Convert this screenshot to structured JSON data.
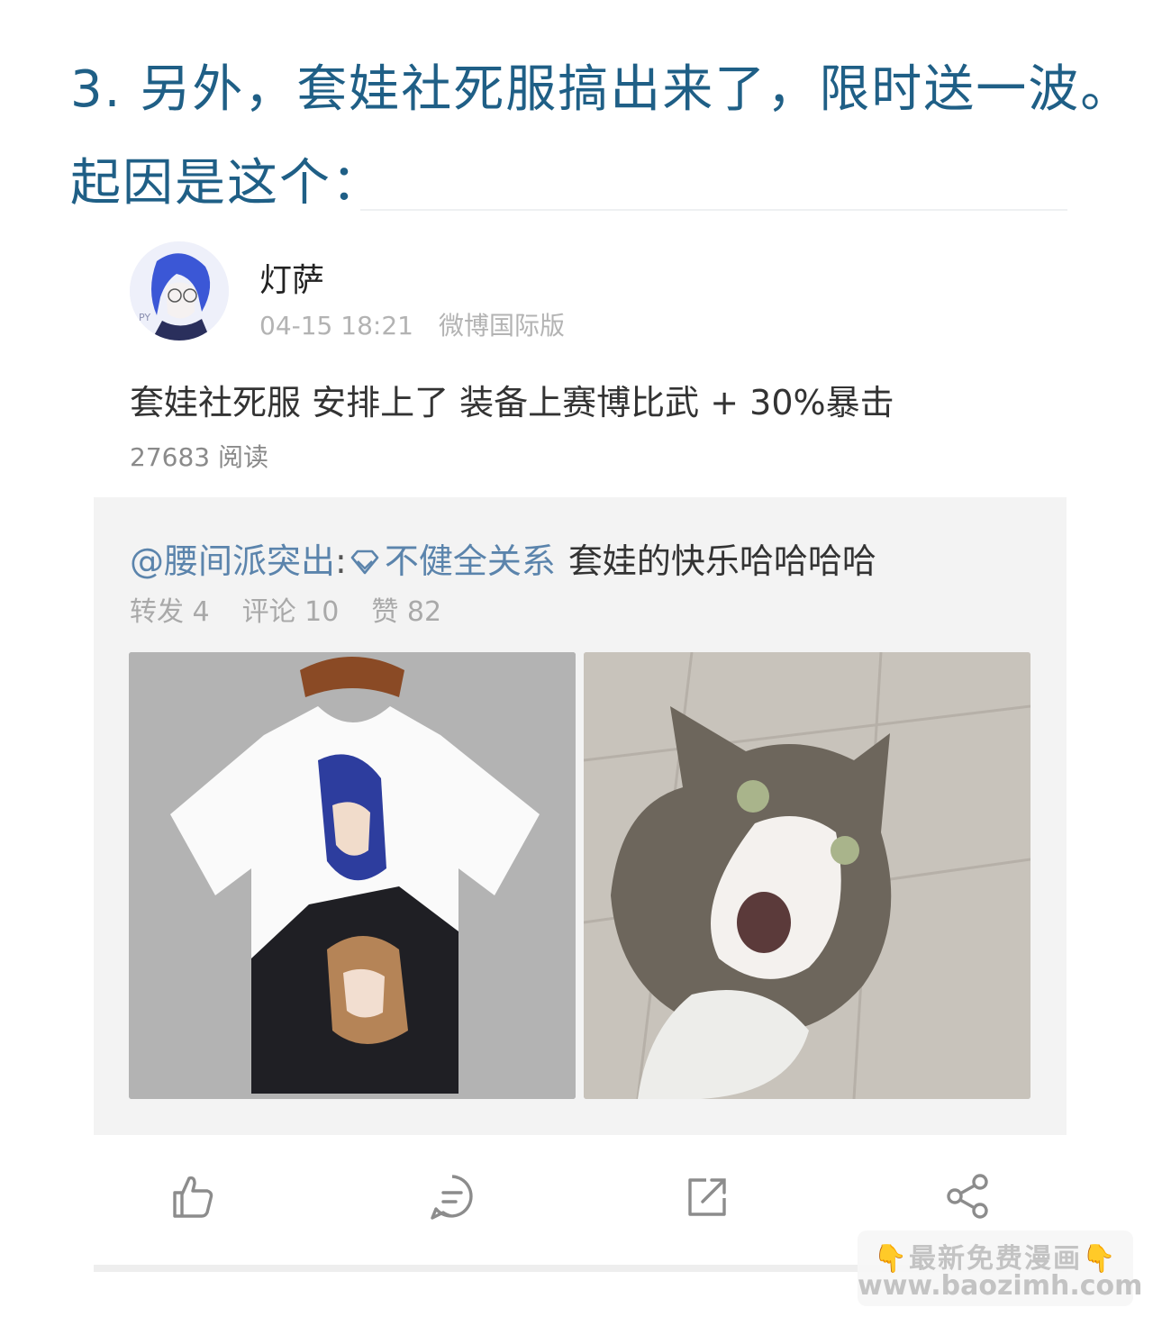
{
  "heading": {
    "line1": "3. 另外，套娃社死服搞出来了，限时送一波。",
    "line2": "起因是这个："
  },
  "post": {
    "username": "灯萨",
    "timestamp": "04-15 18:21",
    "source": "微博国际版",
    "text": "套娃社死服 安排上了 装备上赛博比武 + 30%暴击",
    "reads": "27683 阅读"
  },
  "quoted": {
    "mention": "@腰间派突出",
    "colon": ":",
    "gem_icon": "diamond-icon",
    "tag": "不健全关系",
    "text": "套娃的快乐哈哈哈哈",
    "reposts": "转发 4",
    "comments": "评论 10",
    "likes": "赞 82",
    "images": [
      {
        "description_icon": "tshirt-image"
      },
      {
        "description_icon": "cat-image"
      }
    ]
  },
  "actions": {
    "icons": [
      "thumbs-up-icon",
      "comment-icon",
      "repost-icon",
      "share-icon"
    ]
  },
  "watermark": {
    "hand_left": "👇",
    "title": "最新免费漫画",
    "hand_right": "👇",
    "url": "www.baozimh.com"
  },
  "colors": {
    "heading": "#1f5f86",
    "link": "#5b84ac",
    "muted": "#b3b3b3",
    "quote_bg": "#f3f3f3"
  }
}
